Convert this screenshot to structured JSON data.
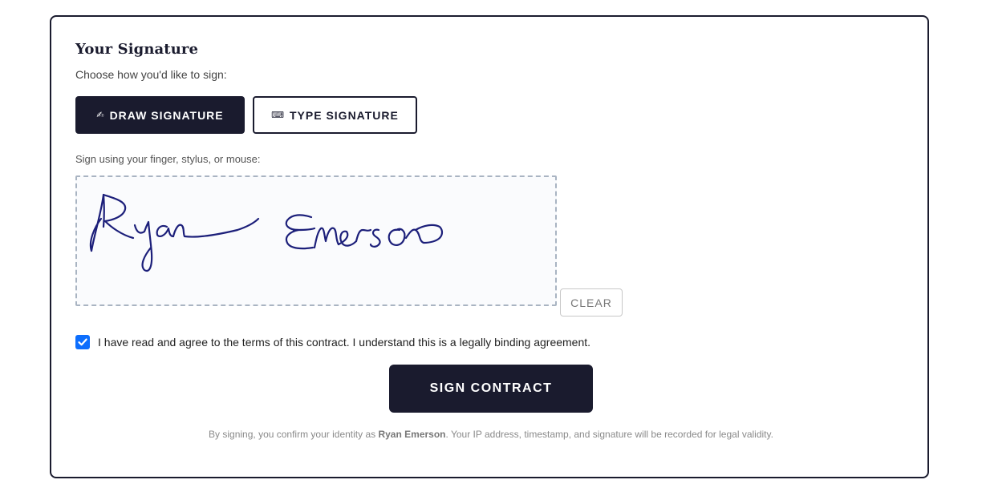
{
  "signature_section": {
    "title": "Your Signature",
    "subtitle": "Choose how you'd like to sign:",
    "modes": {
      "draw": {
        "icon": "✍",
        "icon_name": "writing-hand-icon",
        "label": "DRAW SIGNATURE",
        "active": true
      },
      "type": {
        "icon": "⌨",
        "icon_name": "keyboard-icon",
        "label": "TYPE SIGNATURE",
        "active": false
      }
    },
    "pad_label": "Sign using your finger, stylus, or mouse:",
    "clear_label": "CLEAR"
  },
  "agreement": {
    "checked": true,
    "text": "I have read and agree to the terms of this contract. I understand this is a legally binding agreement."
  },
  "submit": {
    "label": "SIGN CONTRACT"
  },
  "footnote": {
    "prefix": "By signing, you confirm your identity as ",
    "name": "Ryan Emerson",
    "suffix": ". Your IP address, timestamp, and signature will be recorded for legal validity."
  },
  "colors": {
    "primary": "#1a1b2e",
    "checkbox": "#0d6efd",
    "ink": "#1c1f7a"
  }
}
